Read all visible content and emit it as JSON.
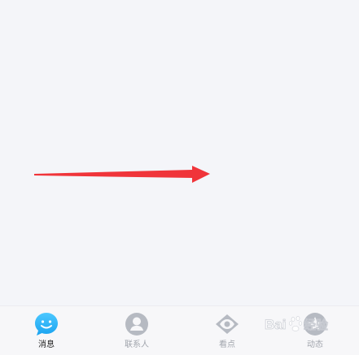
{
  "tabs": [
    {
      "label": "消息",
      "icon": "chat-bubble-icon",
      "active": true
    },
    {
      "label": "联系人",
      "icon": "contact-person-icon",
      "active": false
    },
    {
      "label": "看点",
      "icon": "eye-icon",
      "active": false
    },
    {
      "label": "动态",
      "icon": "star-icon",
      "active": false
    }
  ],
  "colors": {
    "accent": "#2db5ff",
    "arrow": "#f0343a",
    "inactive_icon": "#b6bac2",
    "background": "#f4f5f9"
  },
  "watermark": {
    "text": "Baidu经验"
  }
}
